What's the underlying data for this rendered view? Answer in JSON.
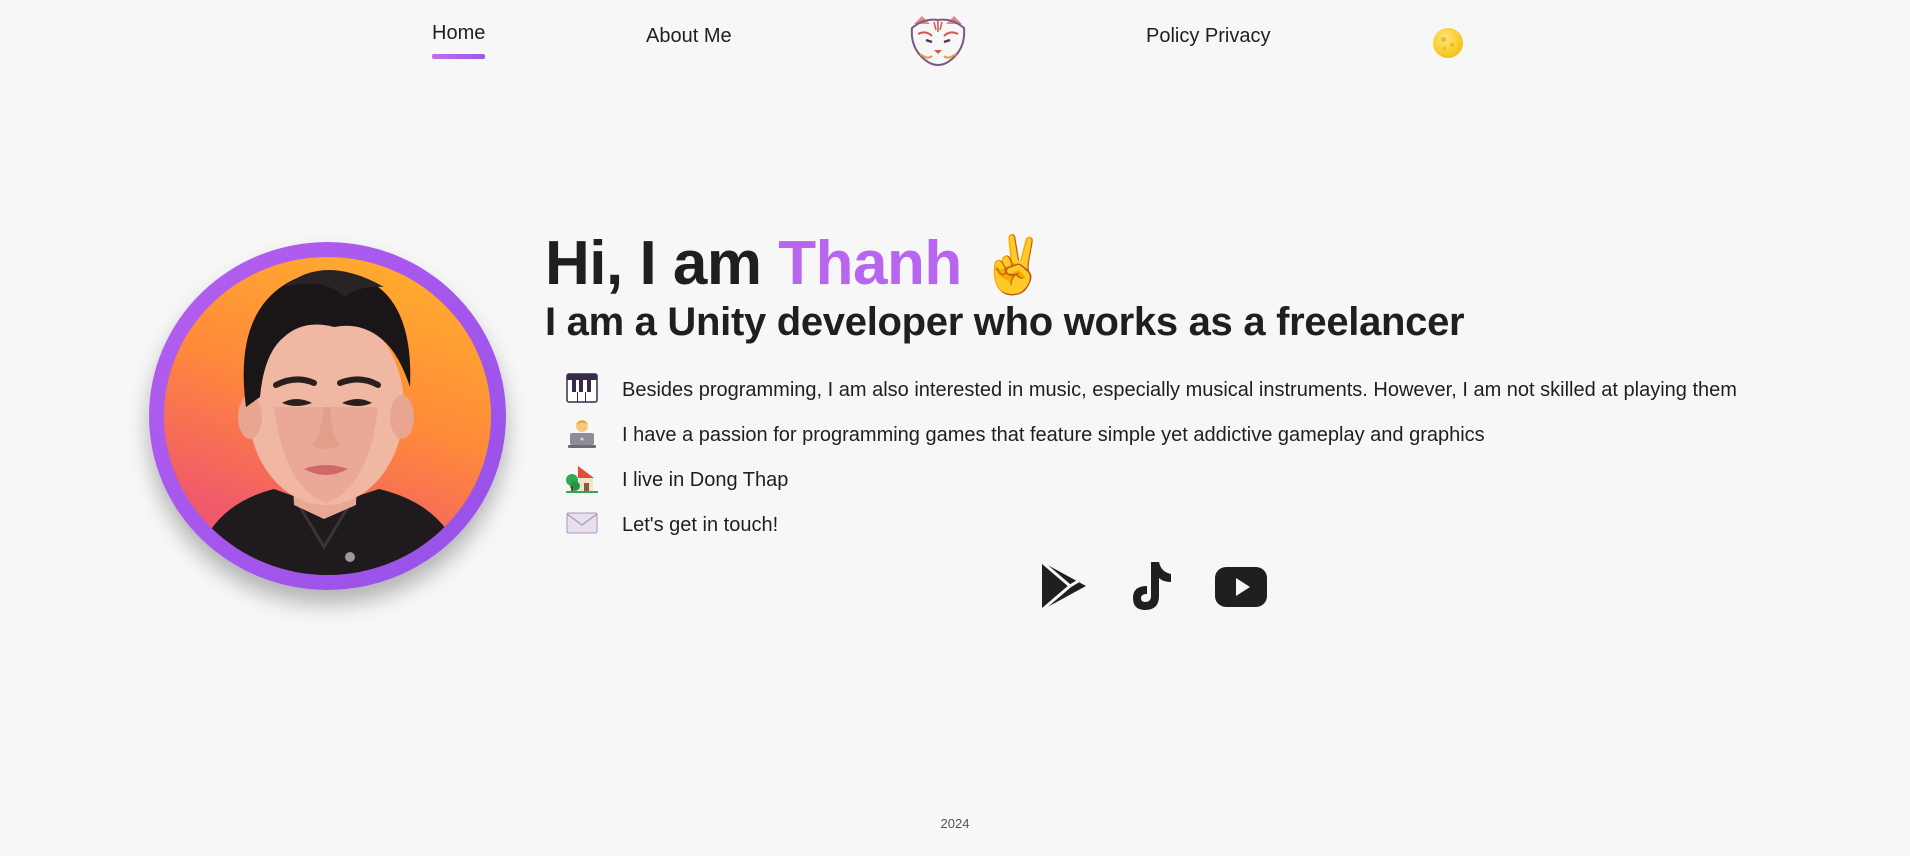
{
  "nav": {
    "home": "Home",
    "about": "About Me",
    "policy": "Policy Privacy",
    "logo_icon": "tiger-logo-icon",
    "theme_icon": "moon-icon"
  },
  "hero": {
    "greeting_prefix": "Hi, I am ",
    "name": "Thanh",
    "wave_emoji": "✌️",
    "subtitle": "I am a Unity developer who works as a freelancer",
    "accent_color": "#b866f0"
  },
  "facts": [
    {
      "icon": "piano-icon",
      "text": "Besides programming, I am also interested in music, especially musical instruments. However, I am not skilled at playing them"
    },
    {
      "icon": "technologist-icon",
      "text": "I have a passion for programming games that feature simple yet addictive gameplay and graphics"
    },
    {
      "icon": "house-icon",
      "text": "I live in Dong Thap"
    },
    {
      "icon": "envelope-icon",
      "text": "Let's get in touch!"
    }
  ],
  "social": [
    {
      "icon": "google-play-icon"
    },
    {
      "icon": "tiktok-icon"
    },
    {
      "icon": "youtube-icon"
    }
  ],
  "footer": {
    "year": "2024"
  }
}
